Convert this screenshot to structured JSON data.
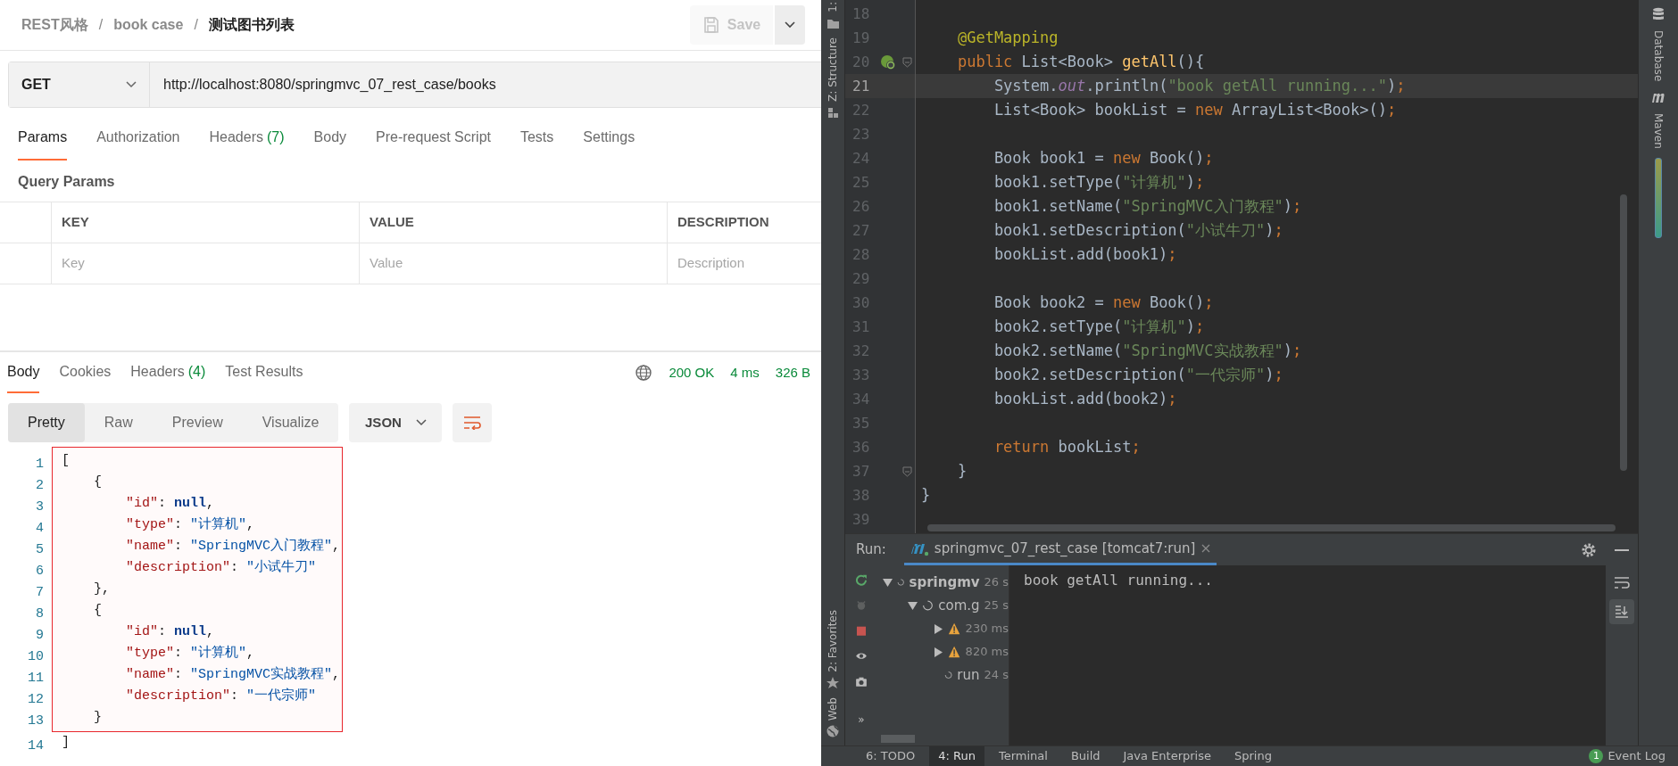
{
  "postman": {
    "breadcrumb": [
      {
        "kind": "link",
        "text": "REST风格"
      },
      {
        "kind": "separator",
        "text": "/"
      },
      {
        "kind": "link",
        "text": "book case"
      },
      {
        "kind": "separator",
        "text": "/"
      },
      {
        "kind": "current",
        "text": "测试图书列表"
      }
    ],
    "save_button": {
      "label": "Save",
      "disabled": true
    },
    "request": {
      "method": "GET",
      "url": "http://localhost:8080/springmvc_07_rest_case/books"
    },
    "request_tabs": [
      {
        "label": "Params",
        "selected": true
      },
      {
        "label": "Authorization",
        "selected": false
      },
      {
        "label": "Headers",
        "count": "(7)",
        "selected": false
      },
      {
        "label": "Body",
        "selected": false
      },
      {
        "label": "Pre-request Script",
        "selected": false
      },
      {
        "label": "Tests",
        "selected": false
      },
      {
        "label": "Settings",
        "selected": false
      }
    ],
    "query_params": {
      "title": "Query Params",
      "columns": [
        {
          "label": "KEY",
          "placeholder": "Key"
        },
        {
          "label": "VALUE",
          "placeholder": "Value"
        },
        {
          "label": "DESCRIPTION",
          "placeholder": "Description"
        }
      ]
    },
    "response": {
      "tabs": [
        {
          "label": "Body",
          "selected": true
        },
        {
          "label": "Cookies",
          "selected": false
        },
        {
          "label": "Headers",
          "count": "(4)",
          "selected": false
        },
        {
          "label": "Test Results",
          "selected": false
        }
      ],
      "status": "200 OK",
      "time": "4 ms",
      "size": "326 B",
      "views": [
        {
          "label": "Pretty",
          "selected": true
        },
        {
          "label": "Raw",
          "selected": false
        },
        {
          "label": "Preview",
          "selected": false
        },
        {
          "label": "Visualize",
          "selected": false
        }
      ],
      "format": "JSON",
      "lines": [
        {
          "number": "1",
          "highlighted": true,
          "tokens": [
            {
              "kind": "punct",
              "text": "["
            }
          ]
        },
        {
          "number": "2",
          "highlighted": true,
          "tokens": [
            {
              "kind": "punct",
              "text": "    {"
            }
          ]
        },
        {
          "number": "3",
          "highlighted": true,
          "tokens": [
            {
              "kind": "key",
              "text": "        \"id\""
            },
            {
              "kind": "punct",
              "text": ": "
            },
            {
              "kind": "null",
              "text": "null"
            },
            {
              "kind": "punct",
              "text": ","
            }
          ]
        },
        {
          "number": "4",
          "highlighted": true,
          "tokens": [
            {
              "kind": "key",
              "text": "        \"type\""
            },
            {
              "kind": "punct",
              "text": ": "
            },
            {
              "kind": "string",
              "text": "\"计算机\""
            },
            {
              "kind": "punct",
              "text": ","
            }
          ]
        },
        {
          "number": "5",
          "highlighted": true,
          "tokens": [
            {
              "kind": "key",
              "text": "        \"name\""
            },
            {
              "kind": "punct",
              "text": ": "
            },
            {
              "kind": "string",
              "text": "\"SpringMVC入门教程\""
            },
            {
              "kind": "punct",
              "text": ","
            }
          ]
        },
        {
          "number": "6",
          "highlighted": true,
          "tokens": [
            {
              "kind": "key",
              "text": "        \"description\""
            },
            {
              "kind": "punct",
              "text": ": "
            },
            {
              "kind": "string",
              "text": "\"小试牛刀\""
            }
          ]
        },
        {
          "number": "7",
          "highlighted": true,
          "tokens": [
            {
              "kind": "punct",
              "text": "    },"
            }
          ]
        },
        {
          "number": "8",
          "highlighted": true,
          "tokens": [
            {
              "kind": "punct",
              "text": "    {"
            }
          ]
        },
        {
          "number": "9",
          "highlighted": true,
          "tokens": [
            {
              "kind": "key",
              "text": "        \"id\""
            },
            {
              "kind": "punct",
              "text": ": "
            },
            {
              "kind": "null",
              "text": "null"
            },
            {
              "kind": "punct",
              "text": ","
            }
          ]
        },
        {
          "number": "10",
          "highlighted": true,
          "tokens": [
            {
              "kind": "key",
              "text": "        \"type\""
            },
            {
              "kind": "punct",
              "text": ": "
            },
            {
              "kind": "string",
              "text": "\"计算机\""
            },
            {
              "kind": "punct",
              "text": ","
            }
          ]
        },
        {
          "number": "11",
          "highlighted": true,
          "tokens": [
            {
              "kind": "key",
              "text": "        \"name\""
            },
            {
              "kind": "punct",
              "text": ": "
            },
            {
              "kind": "string",
              "text": "\"SpringMVC实战教程\""
            },
            {
              "kind": "punct",
              "text": ","
            }
          ]
        },
        {
          "number": "12",
          "highlighted": true,
          "tokens": [
            {
              "kind": "key",
              "text": "        \"description\""
            },
            {
              "kind": "punct",
              "text": ": "
            },
            {
              "kind": "string",
              "text": "\"一代宗师\""
            }
          ]
        },
        {
          "number": "13",
          "highlighted": true,
          "tokens": [
            {
              "kind": "punct",
              "text": "    }"
            }
          ]
        },
        {
          "number": "14",
          "highlighted": false,
          "tokens": [
            {
              "kind": "punct",
              "text": "]"
            }
          ]
        }
      ]
    }
  },
  "ide": {
    "left_tool_tabs_top": [
      {
        "label": "1:"
      },
      {
        "label": "Z: Structure"
      }
    ],
    "left_tool_tabs_bottom": [
      {
        "label": "2: Favorites"
      },
      {
        "label": "Web"
      }
    ],
    "right_tool_tabs": [
      {
        "label": "Database"
      },
      {
        "label": "Maven"
      }
    ],
    "editor": {
      "lines": [
        {
          "number": "18",
          "current": false,
          "fold": false,
          "bean": false
        },
        {
          "number": "19",
          "current": false,
          "fold": false,
          "bean": false,
          "tokens": [
            {
              "kind": "annotation",
              "text": "    @GetMapping"
            }
          ]
        },
        {
          "number": "20",
          "current": false,
          "fold": true,
          "bean": true,
          "tokens": [
            {
              "kind": "keyword",
              "text": "    public"
            },
            {
              "kind": "plain",
              "text": " List<Book> "
            },
            {
              "kind": "method",
              "text": "getAll"
            },
            {
              "kind": "plain",
              "text": "(){"
            }
          ]
        },
        {
          "number": "21",
          "current": true,
          "fold": false,
          "bean": false,
          "tokens": [
            {
              "kind": "plain",
              "text": "        System."
            },
            {
              "kind": "field",
              "text": "out"
            },
            {
              "kind": "plain",
              "text": ".println("
            },
            {
              "kind": "string",
              "text": "\"book getAll running...\""
            },
            {
              "kind": "plain",
              "text": ")"
            },
            {
              "kind": "keyword",
              "text": ";"
            }
          ]
        },
        {
          "number": "22",
          "current": false,
          "fold": false,
          "bean": false,
          "tokens": [
            {
              "kind": "plain",
              "text": "        List<Book> bookList = "
            },
            {
              "kind": "keyword",
              "text": "new"
            },
            {
              "kind": "plain",
              "text": " ArrayList<Book>()"
            },
            {
              "kind": "keyword",
              "text": ";"
            }
          ]
        },
        {
          "number": "23",
          "current": false,
          "fold": false,
          "bean": false
        },
        {
          "number": "24",
          "current": false,
          "fold": false,
          "bean": false,
          "tokens": [
            {
              "kind": "plain",
              "text": "        Book book1 = "
            },
            {
              "kind": "keyword",
              "text": "new"
            },
            {
              "kind": "plain",
              "text": " Book()"
            },
            {
              "kind": "keyword",
              "text": ";"
            }
          ]
        },
        {
          "number": "25",
          "current": false,
          "fold": false,
          "bean": false,
          "tokens": [
            {
              "kind": "plain",
              "text": "        book1.setType("
            },
            {
              "kind": "string",
              "text": "\"计算机\""
            },
            {
              "kind": "plain",
              "text": ")"
            },
            {
              "kind": "keyword",
              "text": ";"
            }
          ]
        },
        {
          "number": "26",
          "current": false,
          "fold": false,
          "bean": false,
          "tokens": [
            {
              "kind": "plain",
              "text": "        book1.setName("
            },
            {
              "kind": "string",
              "text": "\"SpringMVC入门教程\""
            },
            {
              "kind": "plain",
              "text": ")"
            },
            {
              "kind": "keyword",
              "text": ";"
            }
          ]
        },
        {
          "number": "27",
          "current": false,
          "fold": false,
          "bean": false,
          "tokens": [
            {
              "kind": "plain",
              "text": "        book1.setDescription("
            },
            {
              "kind": "string",
              "text": "\"小试牛刀\""
            },
            {
              "kind": "plain",
              "text": ")"
            },
            {
              "kind": "keyword",
              "text": ";"
            }
          ]
        },
        {
          "number": "28",
          "current": false,
          "fold": false,
          "bean": false,
          "tokens": [
            {
              "kind": "plain",
              "text": "        bookList.add(book1)"
            },
            {
              "kind": "keyword",
              "text": ";"
            }
          ]
        },
        {
          "number": "29",
          "current": false,
          "fold": false,
          "bean": false
        },
        {
          "number": "30",
          "current": false,
          "fold": false,
          "bean": false,
          "tokens": [
            {
              "kind": "plain",
              "text": "        Book book2 = "
            },
            {
              "kind": "keyword",
              "text": "new"
            },
            {
              "kind": "plain",
              "text": " Book()"
            },
            {
              "kind": "keyword",
              "text": ";"
            }
          ]
        },
        {
          "number": "31",
          "current": false,
          "fold": false,
          "bean": false,
          "tokens": [
            {
              "kind": "plain",
              "text": "        book2.setType("
            },
            {
              "kind": "string",
              "text": "\"计算机\""
            },
            {
              "kind": "plain",
              "text": ")"
            },
            {
              "kind": "keyword",
              "text": ";"
            }
          ]
        },
        {
          "number": "32",
          "current": false,
          "fold": false,
          "bean": false,
          "tokens": [
            {
              "kind": "plain",
              "text": "        book2.setName("
            },
            {
              "kind": "string",
              "text": "\"SpringMVC实战教程\""
            },
            {
              "kind": "plain",
              "text": ")"
            },
            {
              "kind": "keyword",
              "text": ";"
            }
          ]
        },
        {
          "number": "33",
          "current": false,
          "fold": false,
          "bean": false,
          "tokens": [
            {
              "kind": "plain",
              "text": "        book2.setDescription("
            },
            {
              "kind": "string",
              "text": "\"一代宗师\""
            },
            {
              "kind": "plain",
              "text": ")"
            },
            {
              "kind": "keyword",
              "text": ";"
            }
          ]
        },
        {
          "number": "34",
          "current": false,
          "fold": false,
          "bean": false,
          "tokens": [
            {
              "kind": "plain",
              "text": "        bookList.add(book2)"
            },
            {
              "kind": "keyword",
              "text": ";"
            }
          ]
        },
        {
          "number": "35",
          "current": false,
          "fold": false,
          "bean": false
        },
        {
          "number": "36",
          "current": false,
          "fold": false,
          "bean": false,
          "tokens": [
            {
              "kind": "keyword",
              "text": "        return"
            },
            {
              "kind": "plain",
              "text": " bookList"
            },
            {
              "kind": "keyword",
              "text": ";"
            }
          ]
        },
        {
          "number": "37",
          "current": false,
          "fold": true,
          "bean": false,
          "tokens": [
            {
              "kind": "plain",
              "text": "    }"
            }
          ]
        },
        {
          "number": "38",
          "current": false,
          "fold": false,
          "bean": false,
          "tokens": [
            {
              "kind": "plain",
              "text": "}"
            }
          ]
        },
        {
          "number": "39",
          "current": false,
          "fold": false,
          "bean": false
        }
      ]
    },
    "run": {
      "title": "Run:",
      "tab": "springmvc_07_rest_case [tomcat7:run]",
      "more_tools": "»",
      "tree": [
        {
          "label": "springmv",
          "time": "26 s",
          "kind": "running",
          "bold": true,
          "expanded": true,
          "children": [
            {
              "label": "com.g",
              "time": "25 s",
              "kind": "running",
              "bold": false,
              "expanded": true,
              "children": [
                {
                  "time": "230 ms",
                  "kind": "warning",
                  "expanded": false
                },
                {
                  "time": "820 ms",
                  "kind": "warning",
                  "expanded": false
                },
                {
                  "label": "run",
                  "time": "24 s",
                  "kind": "running",
                  "bold": false
                }
              ]
            }
          ]
        }
      ],
      "console": [
        "book getAll running..."
      ]
    },
    "bottom_tabs": [
      {
        "label": "6: TODO",
        "selected": false
      },
      {
        "label": "4: Run",
        "selected": true
      },
      {
        "label": "Terminal",
        "selected": false
      },
      {
        "label": "Build",
        "selected": false
      },
      {
        "label": "Java Enterprise",
        "selected": false
      },
      {
        "label": "Spring",
        "selected": false
      }
    ],
    "event_log": {
      "count": "1",
      "label": "Event Log"
    }
  }
}
